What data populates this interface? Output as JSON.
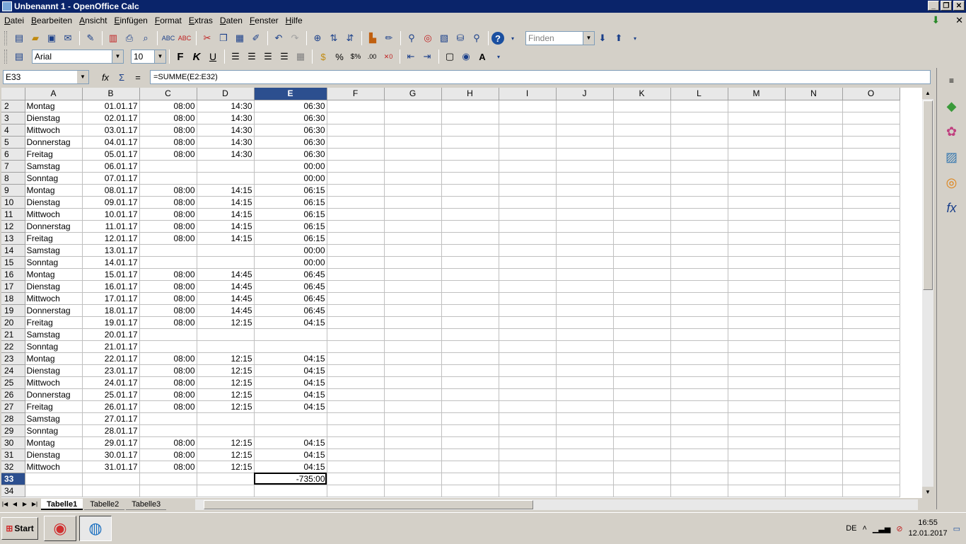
{
  "window": {
    "title": "Unbenannt 1 - OpenOffice Calc",
    "controls": [
      "_",
      "❐",
      "✕"
    ]
  },
  "menu": [
    {
      "key": "D",
      "rest": "atei"
    },
    {
      "key": "B",
      "rest": "earbeiten"
    },
    {
      "key": "A",
      "rest": "nsicht"
    },
    {
      "key": "E",
      "rest": "infügen"
    },
    {
      "key": "F",
      "rest": "ormat"
    },
    {
      "key": "E",
      "rest": "xtras"
    },
    {
      "key": "D",
      "rest": "aten"
    },
    {
      "key": "F",
      "rest": "enster"
    },
    {
      "key": "H",
      "rest": "ilfe"
    }
  ],
  "toolbar": {
    "find_placeholder": "Finden"
  },
  "formatting": {
    "font_name": "Arial",
    "font_size": "10",
    "bold_label": "F",
    "italic_label": "K",
    "underline_label": "U"
  },
  "formula_bar": {
    "cell_ref": "E33",
    "formula": "=SUMME(E2:E32)"
  },
  "columns": [
    "A",
    "B",
    "C",
    "D",
    "E",
    "F",
    "G",
    "H",
    "I",
    "J",
    "K",
    "L",
    "M",
    "N",
    "O"
  ],
  "rows": [
    {
      "n": "2",
      "a": "Montag",
      "b": "01.01.17",
      "c": "08:00",
      "d": "14:30",
      "e": "06:30"
    },
    {
      "n": "3",
      "a": "Dienstag",
      "b": "02.01.17",
      "c": "08:00",
      "d": "14:30",
      "e": "06:30"
    },
    {
      "n": "4",
      "a": "Mittwoch",
      "b": "03.01.17",
      "c": "08:00",
      "d": "14:30",
      "e": "06:30"
    },
    {
      "n": "5",
      "a": "Donnerstag",
      "b": "04.01.17",
      "c": "08:00",
      "d": "14:30",
      "e": "06:30"
    },
    {
      "n": "6",
      "a": "Freitag",
      "b": "05.01.17",
      "c": "08:00",
      "d": "14:30",
      "e": "06:30"
    },
    {
      "n": "7",
      "a": "Samstag",
      "b": "06.01.17",
      "c": "",
      "d": "",
      "e": "00:00"
    },
    {
      "n": "8",
      "a": "Sonntag",
      "b": "07.01.17",
      "c": "",
      "d": "",
      "e": "00:00"
    },
    {
      "n": "9",
      "a": "Montag",
      "b": "08.01.17",
      "c": "08:00",
      "d": "14:15",
      "e": "06:15"
    },
    {
      "n": "10",
      "a": "Dienstag",
      "b": "09.01.17",
      "c": "08:00",
      "d": "14:15",
      "e": "06:15"
    },
    {
      "n": "11",
      "a": "Mittwoch",
      "b": "10.01.17",
      "c": "08:00",
      "d": "14:15",
      "e": "06:15"
    },
    {
      "n": "12",
      "a": "Donnerstag",
      "b": "11.01.17",
      "c": "08:00",
      "d": "14:15",
      "e": "06:15"
    },
    {
      "n": "13",
      "a": "Freitag",
      "b": "12.01.17",
      "c": "08:00",
      "d": "14:15",
      "e": "06:15"
    },
    {
      "n": "14",
      "a": "Samstag",
      "b": "13.01.17",
      "c": "",
      "d": "",
      "e": "00:00"
    },
    {
      "n": "15",
      "a": "Sonntag",
      "b": "14.01.17",
      "c": "",
      "d": "",
      "e": "00:00"
    },
    {
      "n": "16",
      "a": "Montag",
      "b": "15.01.17",
      "c": "08:00",
      "d": "14:45",
      "e": "06:45"
    },
    {
      "n": "17",
      "a": "Dienstag",
      "b": "16.01.17",
      "c": "08:00",
      "d": "14:45",
      "e": "06:45"
    },
    {
      "n": "18",
      "a": "Mittwoch",
      "b": "17.01.17",
      "c": "08:00",
      "d": "14:45",
      "e": "06:45"
    },
    {
      "n": "19",
      "a": "Donnerstag",
      "b": "18.01.17",
      "c": "08:00",
      "d": "14:45",
      "e": "06:45"
    },
    {
      "n": "20",
      "a": "Freitag",
      "b": "19.01.17",
      "c": "08:00",
      "d": "12:15",
      "e": "04:15"
    },
    {
      "n": "21",
      "a": "Samstag",
      "b": "20.01.17",
      "c": "",
      "d": "",
      "e": ""
    },
    {
      "n": "22",
      "a": "Sonntag",
      "b": "21.01.17",
      "c": "",
      "d": "",
      "e": ""
    },
    {
      "n": "23",
      "a": "Montag",
      "b": "22.01.17",
      "c": "08:00",
      "d": "12:15",
      "e": "04:15"
    },
    {
      "n": "24",
      "a": "Dienstag",
      "b": "23.01.17",
      "c": "08:00",
      "d": "12:15",
      "e": "04:15"
    },
    {
      "n": "25",
      "a": "Mittwoch",
      "b": "24.01.17",
      "c": "08:00",
      "d": "12:15",
      "e": "04:15"
    },
    {
      "n": "26",
      "a": "Donnerstag",
      "b": "25.01.17",
      "c": "08:00",
      "d": "12:15",
      "e": "04:15"
    },
    {
      "n": "27",
      "a": "Freitag",
      "b": "26.01.17",
      "c": "08:00",
      "d": "12:15",
      "e": "04:15"
    },
    {
      "n": "28",
      "a": "Samstag",
      "b": "27.01.17",
      "c": "",
      "d": "",
      "e": ""
    },
    {
      "n": "29",
      "a": "Sonntag",
      "b": "28.01.17",
      "c": "",
      "d": "",
      "e": ""
    },
    {
      "n": "30",
      "a": "Montag",
      "b": "29.01.17",
      "c": "08:00",
      "d": "12:15",
      "e": "04:15"
    },
    {
      "n": "31",
      "a": "Dienstag",
      "b": "30.01.17",
      "c": "08:00",
      "d": "12:15",
      "e": "04:15"
    },
    {
      "n": "32",
      "a": "Mittwoch",
      "b": "31.01.17",
      "c": "08:00",
      "d": "12:15",
      "e": "04:15"
    },
    {
      "n": "33",
      "a": "",
      "b": "",
      "c": "",
      "d": "",
      "e": "-735:00"
    },
    {
      "n": "34",
      "a": "",
      "b": "",
      "c": "",
      "d": "",
      "e": ""
    }
  ],
  "selected": {
    "row": "33",
    "col": "E"
  },
  "sheets": [
    "Tabelle1",
    "Tabelle2",
    "Tabelle3"
  ],
  "active_sheet": "Tabelle1",
  "taskbar": {
    "start_label": "Start",
    "language": "DE",
    "time": "16:55",
    "date": "12.01.2017"
  },
  "colors": {
    "title_bar": "#0a246a",
    "selected_header": "#2c4f8f"
  }
}
